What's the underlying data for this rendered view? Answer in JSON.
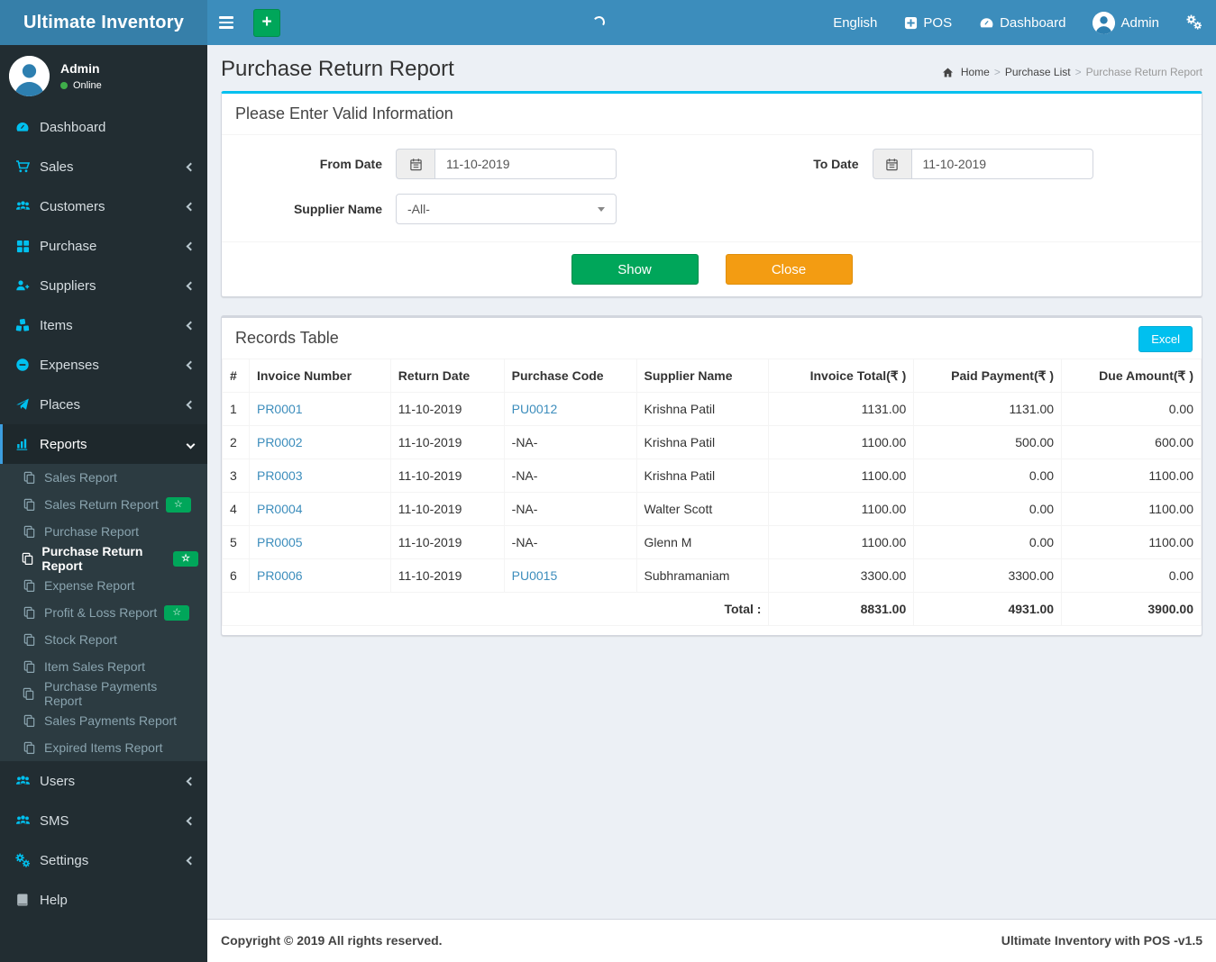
{
  "app": {
    "brand": "Ultimate Inventory",
    "footer_left": "Copyright © 2019 All rights reserved.",
    "footer_right": "Ultimate Inventory with POS -v1.5"
  },
  "navbar": {
    "english_label": "English",
    "pos_label": "POS",
    "dashboard_label": "Dashboard",
    "admin_label": "Admin"
  },
  "user_panel": {
    "name": "Admin",
    "status": "Online"
  },
  "icons": {
    "star": "☆",
    "plus": "+"
  },
  "sidebar": {
    "menu": [
      {
        "label": "Dashboard"
      },
      {
        "label": "Sales"
      },
      {
        "label": "Customers"
      },
      {
        "label": "Purchase"
      },
      {
        "label": "Suppliers"
      },
      {
        "label": "Items"
      },
      {
        "label": "Expenses"
      },
      {
        "label": "Places"
      },
      {
        "label": "Reports"
      },
      {
        "label": "Users"
      },
      {
        "label": "SMS"
      },
      {
        "label": "Settings"
      },
      {
        "label": "Help"
      }
    ],
    "reports_submenu": [
      {
        "label": "Sales Report"
      },
      {
        "label": "Sales Return Report",
        "badge": "star"
      },
      {
        "label": "Purchase Report"
      },
      {
        "label": "Purchase Return Report",
        "badge": "star",
        "active": true
      },
      {
        "label": "Expense Report"
      },
      {
        "label": "Profit & Loss Report",
        "badge": "star"
      },
      {
        "label": "Stock Report"
      },
      {
        "label": "Item Sales Report"
      },
      {
        "label": "Purchase Payments Report"
      },
      {
        "label": "Sales Payments Report"
      },
      {
        "label": "Expired Items Report"
      }
    ]
  },
  "page": {
    "title": "Purchase Return Report",
    "breadcrumb": [
      "Home",
      "Purchase List",
      "Purchase Return Report"
    ]
  },
  "filter": {
    "panel_title": "Please Enter Valid Information",
    "from_date": {
      "label": "From Date",
      "value": "11-10-2019"
    },
    "to_date": {
      "label": "To Date",
      "value": "11-10-2019"
    },
    "supplier": {
      "label": "Supplier Name",
      "value": "-All-"
    },
    "show_button": "Show",
    "close_button": "Close"
  },
  "records": {
    "panel_title": "Records Table",
    "excel_button": "Excel",
    "columns": [
      "#",
      "Invoice Number",
      "Return Date",
      "Purchase Code",
      "Supplier Name",
      "Invoice Total(₹ )",
      "Paid Payment(₹ )",
      "Due Amount(₹ )"
    ],
    "rows": [
      {
        "sn": "1",
        "invoice": "PR0001",
        "return_date": "11-10-2019",
        "purchase_code": "PU0012",
        "supplier": "Krishna Patil",
        "invoice_total": "1131.00",
        "paid": "1131.00",
        "due": "0.00"
      },
      {
        "sn": "2",
        "invoice": "PR0002",
        "return_date": "11-10-2019",
        "purchase_code": "-NA-",
        "supplier": "Krishna Patil",
        "invoice_total": "1100.00",
        "paid": "500.00",
        "due": "600.00"
      },
      {
        "sn": "3",
        "invoice": "PR0003",
        "return_date": "11-10-2019",
        "purchase_code": "-NA-",
        "supplier": "Krishna Patil",
        "invoice_total": "1100.00",
        "paid": "0.00",
        "due": "1100.00"
      },
      {
        "sn": "4",
        "invoice": "PR0004",
        "return_date": "11-10-2019",
        "purchase_code": "-NA-",
        "supplier": "Walter Scott",
        "invoice_total": "1100.00",
        "paid": "0.00",
        "due": "1100.00"
      },
      {
        "sn": "5",
        "invoice": "PR0005",
        "return_date": "11-10-2019",
        "purchase_code": "-NA-",
        "supplier": "Glenn M",
        "invoice_total": "1100.00",
        "paid": "0.00",
        "due": "1100.00"
      },
      {
        "sn": "6",
        "invoice": "PR0006",
        "return_date": "11-10-2019",
        "purchase_code": "PU0015",
        "supplier": "Subhramaniam",
        "invoice_total": "3300.00",
        "paid": "3300.00",
        "due": "0.00"
      }
    ],
    "total": {
      "label": "Total :",
      "invoice_total": "8831.00",
      "paid": "4931.00",
      "due": "3900.00"
    }
  }
}
